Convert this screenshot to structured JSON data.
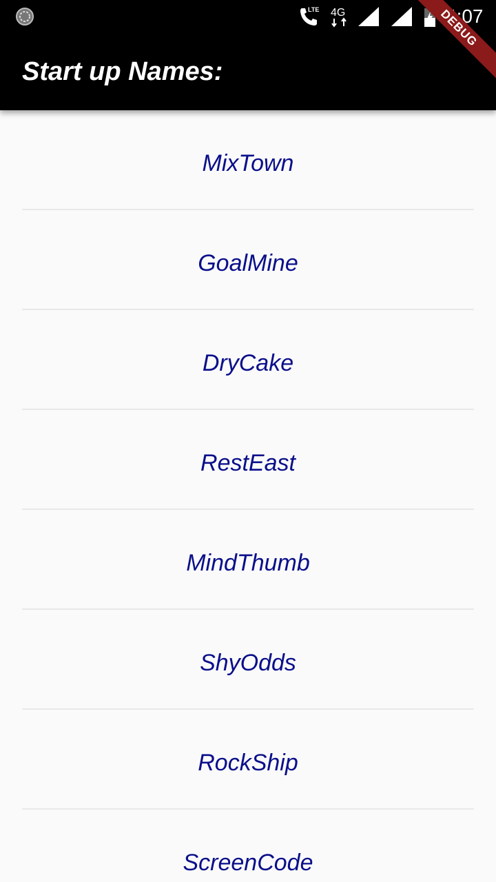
{
  "status_bar": {
    "time": "4:07",
    "network_type": "4G",
    "lte_label": "LTE",
    "icons": [
      "sync-icon",
      "wifi-calling-icon",
      "4g-data-icon",
      "signal-icon",
      "signal-icon",
      "battery-icon"
    ]
  },
  "debug_banner": {
    "label": "DEBUG",
    "color": "#8b1a1a"
  },
  "app_bar": {
    "title": "Start up Names:"
  },
  "names": [
    {
      "label": "MixTown"
    },
    {
      "label": "GoalMine"
    },
    {
      "label": "DryCake"
    },
    {
      "label": "RestEast"
    },
    {
      "label": "MindThumb"
    },
    {
      "label": "ShyOdds"
    },
    {
      "label": "RockShip"
    },
    {
      "label": "ScreenCode"
    }
  ],
  "colors": {
    "item_text": "#0a0f8a",
    "background": "#fafafa",
    "app_bar": "#000000"
  }
}
